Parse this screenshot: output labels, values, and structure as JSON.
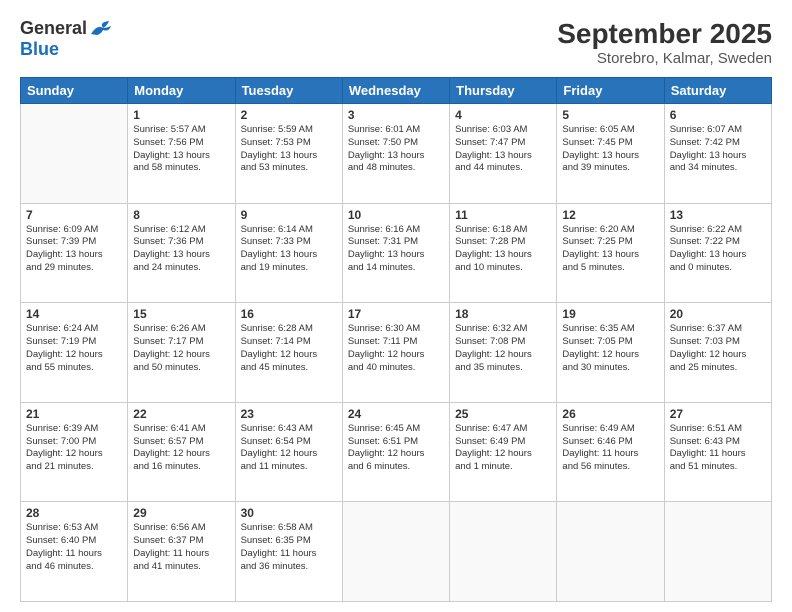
{
  "header": {
    "logo_general": "General",
    "logo_blue": "Blue",
    "main_title": "September 2025",
    "sub_title": "Storebro, Kalmar, Sweden"
  },
  "days": [
    "Sunday",
    "Monday",
    "Tuesday",
    "Wednesday",
    "Thursday",
    "Friday",
    "Saturday"
  ],
  "weeks": [
    [
      {
        "day": "",
        "info": ""
      },
      {
        "day": "1",
        "info": "Sunrise: 5:57 AM\nSunset: 7:56 PM\nDaylight: 13 hours\nand 58 minutes."
      },
      {
        "day": "2",
        "info": "Sunrise: 5:59 AM\nSunset: 7:53 PM\nDaylight: 13 hours\nand 53 minutes."
      },
      {
        "day": "3",
        "info": "Sunrise: 6:01 AM\nSunset: 7:50 PM\nDaylight: 13 hours\nand 48 minutes."
      },
      {
        "day": "4",
        "info": "Sunrise: 6:03 AM\nSunset: 7:47 PM\nDaylight: 13 hours\nand 44 minutes."
      },
      {
        "day": "5",
        "info": "Sunrise: 6:05 AM\nSunset: 7:45 PM\nDaylight: 13 hours\nand 39 minutes."
      },
      {
        "day": "6",
        "info": "Sunrise: 6:07 AM\nSunset: 7:42 PM\nDaylight: 13 hours\nand 34 minutes."
      }
    ],
    [
      {
        "day": "7",
        "info": "Sunrise: 6:09 AM\nSunset: 7:39 PM\nDaylight: 13 hours\nand 29 minutes."
      },
      {
        "day": "8",
        "info": "Sunrise: 6:12 AM\nSunset: 7:36 PM\nDaylight: 13 hours\nand 24 minutes."
      },
      {
        "day": "9",
        "info": "Sunrise: 6:14 AM\nSunset: 7:33 PM\nDaylight: 13 hours\nand 19 minutes."
      },
      {
        "day": "10",
        "info": "Sunrise: 6:16 AM\nSunset: 7:31 PM\nDaylight: 13 hours\nand 14 minutes."
      },
      {
        "day": "11",
        "info": "Sunrise: 6:18 AM\nSunset: 7:28 PM\nDaylight: 13 hours\nand 10 minutes."
      },
      {
        "day": "12",
        "info": "Sunrise: 6:20 AM\nSunset: 7:25 PM\nDaylight: 13 hours\nand 5 minutes."
      },
      {
        "day": "13",
        "info": "Sunrise: 6:22 AM\nSunset: 7:22 PM\nDaylight: 13 hours\nand 0 minutes."
      }
    ],
    [
      {
        "day": "14",
        "info": "Sunrise: 6:24 AM\nSunset: 7:19 PM\nDaylight: 12 hours\nand 55 minutes."
      },
      {
        "day": "15",
        "info": "Sunrise: 6:26 AM\nSunset: 7:17 PM\nDaylight: 12 hours\nand 50 minutes."
      },
      {
        "day": "16",
        "info": "Sunrise: 6:28 AM\nSunset: 7:14 PM\nDaylight: 12 hours\nand 45 minutes."
      },
      {
        "day": "17",
        "info": "Sunrise: 6:30 AM\nSunset: 7:11 PM\nDaylight: 12 hours\nand 40 minutes."
      },
      {
        "day": "18",
        "info": "Sunrise: 6:32 AM\nSunset: 7:08 PM\nDaylight: 12 hours\nand 35 minutes."
      },
      {
        "day": "19",
        "info": "Sunrise: 6:35 AM\nSunset: 7:05 PM\nDaylight: 12 hours\nand 30 minutes."
      },
      {
        "day": "20",
        "info": "Sunrise: 6:37 AM\nSunset: 7:03 PM\nDaylight: 12 hours\nand 25 minutes."
      }
    ],
    [
      {
        "day": "21",
        "info": "Sunrise: 6:39 AM\nSunset: 7:00 PM\nDaylight: 12 hours\nand 21 minutes."
      },
      {
        "day": "22",
        "info": "Sunrise: 6:41 AM\nSunset: 6:57 PM\nDaylight: 12 hours\nand 16 minutes."
      },
      {
        "day": "23",
        "info": "Sunrise: 6:43 AM\nSunset: 6:54 PM\nDaylight: 12 hours\nand 11 minutes."
      },
      {
        "day": "24",
        "info": "Sunrise: 6:45 AM\nSunset: 6:51 PM\nDaylight: 12 hours\nand 6 minutes."
      },
      {
        "day": "25",
        "info": "Sunrise: 6:47 AM\nSunset: 6:49 PM\nDaylight: 12 hours\nand 1 minute."
      },
      {
        "day": "26",
        "info": "Sunrise: 6:49 AM\nSunset: 6:46 PM\nDaylight: 11 hours\nand 56 minutes."
      },
      {
        "day": "27",
        "info": "Sunrise: 6:51 AM\nSunset: 6:43 PM\nDaylight: 11 hours\nand 51 minutes."
      }
    ],
    [
      {
        "day": "28",
        "info": "Sunrise: 6:53 AM\nSunset: 6:40 PM\nDaylight: 11 hours\nand 46 minutes."
      },
      {
        "day": "29",
        "info": "Sunrise: 6:56 AM\nSunset: 6:37 PM\nDaylight: 11 hours\nand 41 minutes."
      },
      {
        "day": "30",
        "info": "Sunrise: 6:58 AM\nSunset: 6:35 PM\nDaylight: 11 hours\nand 36 minutes."
      },
      {
        "day": "",
        "info": ""
      },
      {
        "day": "",
        "info": ""
      },
      {
        "day": "",
        "info": ""
      },
      {
        "day": "",
        "info": ""
      }
    ]
  ]
}
